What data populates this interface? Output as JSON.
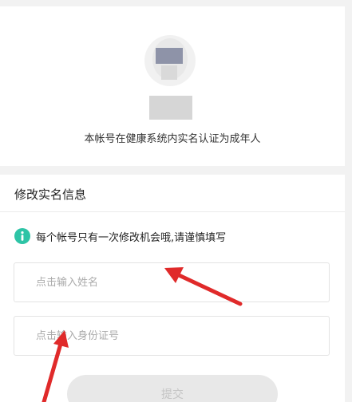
{
  "verification": {
    "status_text": "本帐号在健康系统内实名认证为成年人"
  },
  "form": {
    "title": "修改实名信息",
    "notice": "每个帐号只有一次修改机会哦,请谨慎填写",
    "notice_icon": "info-icon",
    "name_placeholder": "点击输入姓名",
    "id_placeholder": "点击输入身份证号",
    "submit_label": "提交"
  },
  "colors": {
    "accent": "#2ec4a6",
    "annotation_arrow": "#e02a2a",
    "disabled_button": "#e8e8e8"
  }
}
